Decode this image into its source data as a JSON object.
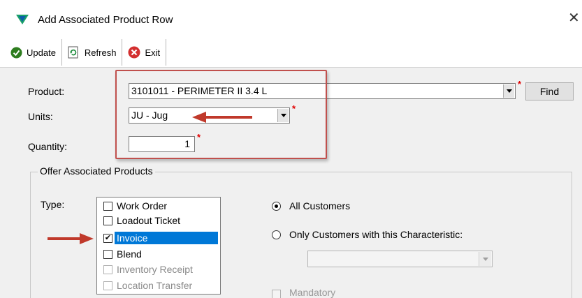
{
  "window": {
    "title": "Add Associated Product Row",
    "close_glyph": "✕"
  },
  "toolbar": {
    "buttons": [
      {
        "label": "Update",
        "icon": "update-check-icon"
      },
      {
        "label": "Refresh",
        "icon": "refresh-icon"
      },
      {
        "label": "Exit",
        "icon": "exit-x-icon"
      }
    ]
  },
  "form": {
    "product": {
      "label": "Product:",
      "value": "3101011 - PERIMETER II 3.4 L",
      "required": "*"
    },
    "find_label": "Find",
    "units": {
      "label": "Units:",
      "value": "JU - Jug",
      "required": "*"
    },
    "quantity": {
      "label": "Quantity:",
      "value": "1",
      "required": "*"
    }
  },
  "offer": {
    "group_title": "Offer Associated Products",
    "type_label": "Type:",
    "types": [
      {
        "label": "Work Order",
        "checked": false,
        "enabled": true
      },
      {
        "label": "Loadout Ticket",
        "checked": false,
        "enabled": true
      },
      {
        "label": "Invoice",
        "checked": true,
        "enabled": true,
        "selected": true
      },
      {
        "label": "Blend",
        "checked": false,
        "enabled": true
      },
      {
        "label": "Inventory Receipt",
        "checked": false,
        "enabled": false
      },
      {
        "label": "Location Transfer",
        "checked": false,
        "enabled": false
      }
    ],
    "all_customers_label": "All Customers",
    "only_customers_label": "Only Customers with this Characteristic:",
    "mandatory_label": "Mandatory"
  },
  "colors": {
    "highlight": "#c0504d",
    "arrow": "#c0392b",
    "selection": "#0078d7",
    "required": "#e00000"
  }
}
